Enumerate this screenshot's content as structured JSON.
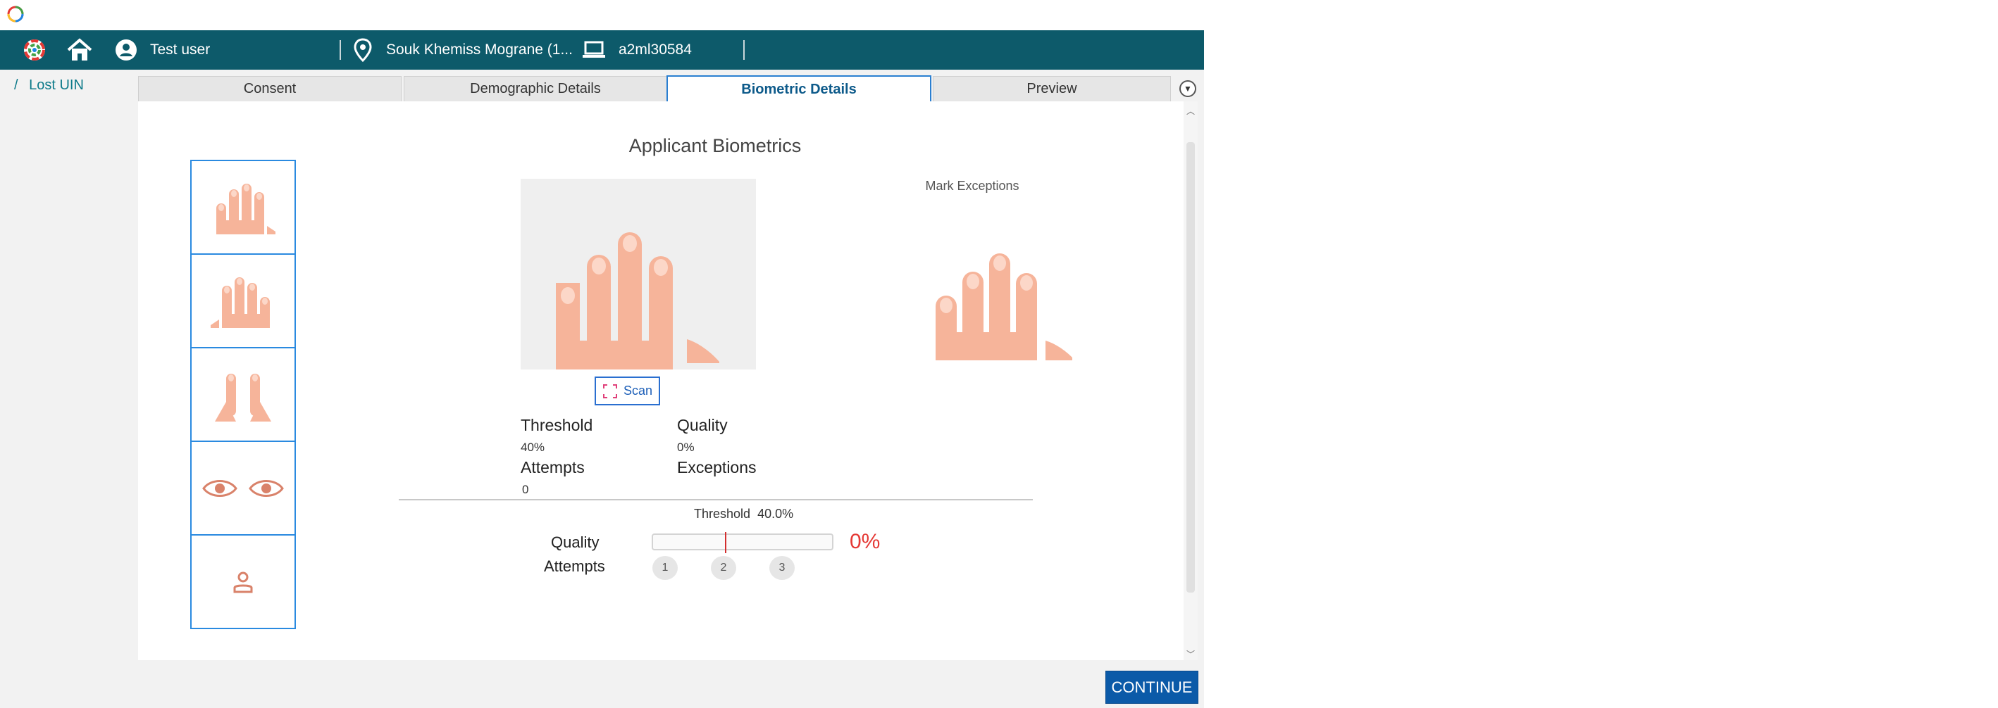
{
  "header": {
    "user": "Test user",
    "location": "Souk Khemiss Mograne (1...",
    "machine": "a2ml30584"
  },
  "breadcrumb": {
    "separator": "/",
    "label": "Lost UIN"
  },
  "tabs": [
    {
      "label": "Consent"
    },
    {
      "label": "Demographic Details"
    },
    {
      "label": "Biometric Details"
    },
    {
      "label": "Preview"
    }
  ],
  "active_tab_index": 2,
  "biometrics": {
    "title": "Applicant Biometrics",
    "mark_exceptions": "Mark Exceptions",
    "scan_label": "Scan",
    "threshold_label": "Threshold",
    "threshold_value": "40%",
    "quality_label": "Quality",
    "quality_value": "0%",
    "attempts_label": "Attempts",
    "attempts_value": "0",
    "exceptions_label": "Exceptions"
  },
  "quality_panel": {
    "threshold_label": "Threshold",
    "threshold_value": "40.0%",
    "quality_label": "Quality",
    "attempts_label": "Attempts",
    "quality_percent": "0%",
    "quality_fraction": 0,
    "threshold_fraction": 0.4,
    "attempts": [
      "1",
      "2",
      "3"
    ]
  },
  "continue_label": "CONTINUE",
  "colors": {
    "header_bg": "#0d5a6a",
    "accent": "#2a8ae0",
    "hand": "#f6b49a",
    "error": "#e53935",
    "button": "#0b5aa8"
  },
  "icons": [
    "app-logo-icon",
    "home-icon",
    "user-icon",
    "location-icon",
    "laptop-icon",
    "dropdown-icon",
    "scan-icon",
    "eye-icon",
    "person-icon"
  ]
}
